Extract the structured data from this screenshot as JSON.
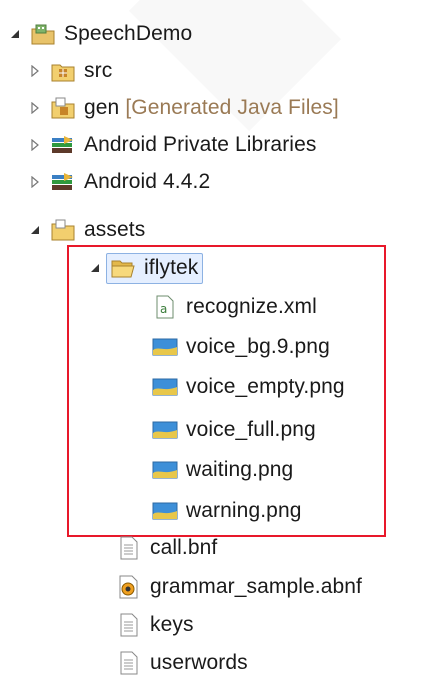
{
  "tree": {
    "project": "SpeechDemo",
    "src": "src",
    "gen": "gen",
    "gen_decoration": "[Generated Java Files]",
    "android_private_libraries": "Android Private Libraries",
    "android_version": "Android 4.4.2",
    "assets": "assets",
    "iflytek": "iflytek",
    "files_in_iflytek": [
      "recognize.xml",
      "voice_bg.9.png",
      "voice_empty.png",
      "voice_full.png",
      "waiting.png",
      "warning.png"
    ],
    "files_in_assets": [
      "call.bnf",
      "grammar_sample.abnf",
      "keys",
      "userwords"
    ]
  },
  "colors": {
    "highlight_border": "#e8182a",
    "selection_bg": "#e5efff",
    "selection_border": "#8db2e3",
    "decoration_text": "#9a7a55"
  }
}
